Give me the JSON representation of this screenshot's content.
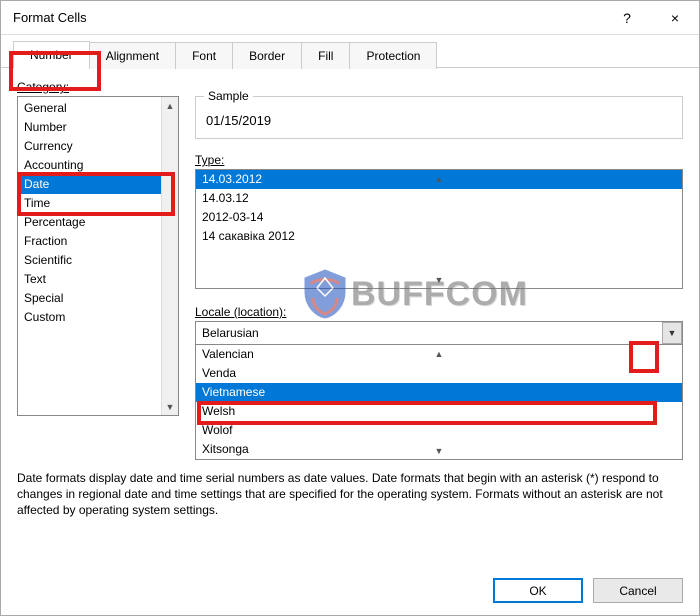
{
  "window": {
    "title": "Format Cells",
    "help": "?",
    "close": "×"
  },
  "tabs": {
    "items": [
      {
        "label": "Number",
        "active": true
      },
      {
        "label": "Alignment",
        "active": false
      },
      {
        "label": "Font",
        "active": false
      },
      {
        "label": "Border",
        "active": false
      },
      {
        "label": "Fill",
        "active": false
      },
      {
        "label": "Protection",
        "active": false
      }
    ]
  },
  "category": {
    "label": "Category:",
    "items": [
      {
        "label": "General"
      },
      {
        "label": "Number"
      },
      {
        "label": "Currency"
      },
      {
        "label": "Accounting"
      },
      {
        "label": "Date",
        "selected": true
      },
      {
        "label": "Time"
      },
      {
        "label": "Percentage"
      },
      {
        "label": "Fraction"
      },
      {
        "label": "Scientific"
      },
      {
        "label": "Text"
      },
      {
        "label": "Special"
      },
      {
        "label": "Custom"
      }
    ]
  },
  "sample": {
    "label": "Sample",
    "value": "01/15/2019"
  },
  "type": {
    "label": "Type:",
    "items": [
      {
        "label": "14.03.2012",
        "selected": true
      },
      {
        "label": "14.03.12"
      },
      {
        "label": "2012-03-14"
      },
      {
        "label": "14 сакавіка 2012"
      }
    ]
  },
  "locale": {
    "label": "Locale (location):",
    "value": "Belarusian",
    "options": [
      {
        "label": "Valencian"
      },
      {
        "label": "Venda"
      },
      {
        "label": "Vietnamese",
        "selected": true
      },
      {
        "label": "Welsh"
      },
      {
        "label": "Wolof"
      },
      {
        "label": "Xitsonga"
      }
    ]
  },
  "description": "Date formats display date and time serial numbers as date values. Date formats that begin with an asterisk (*) respond to changes in regional date and time settings that are specified for the operating system. Formats without an asterisk are not affected by operating system settings.",
  "buttons": {
    "ok": "OK",
    "cancel": "Cancel"
  },
  "watermark": {
    "text": "BUFFCOM"
  },
  "colors": {
    "selection": "#0078d7",
    "highlight": "#e21b1b"
  }
}
